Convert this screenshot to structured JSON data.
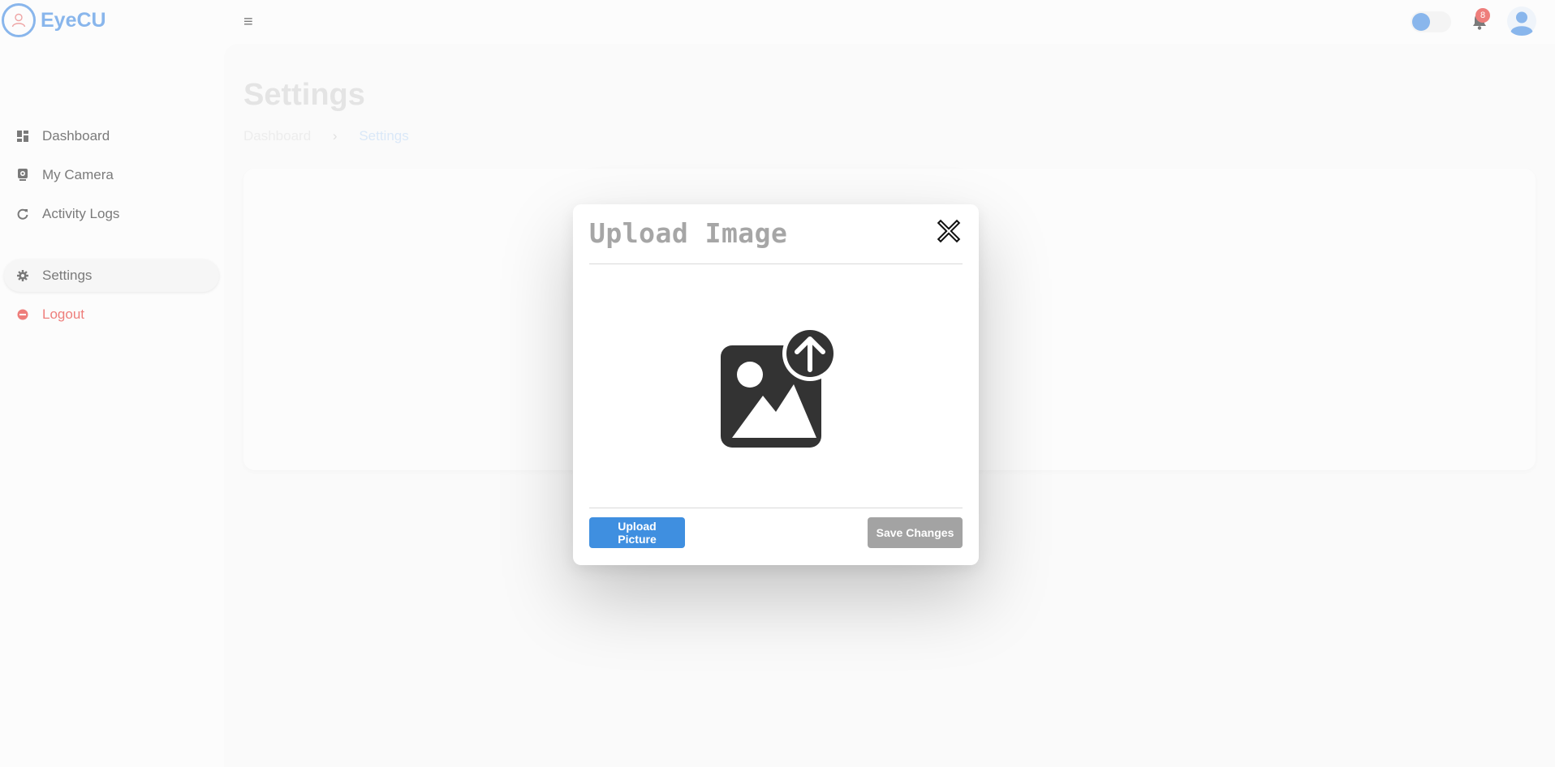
{
  "app": {
    "name": "EyeCU"
  },
  "header": {
    "notification_count": "8",
    "theme_toggle_on": true
  },
  "sidebar": {
    "items": [
      {
        "label": "Dashboard",
        "icon": "dashboard-icon"
      },
      {
        "label": "My Camera",
        "icon": "camera-icon"
      },
      {
        "label": "Activity Logs",
        "icon": "refresh-icon"
      },
      {
        "label": "Settings",
        "icon": "gear-icon",
        "active": true
      },
      {
        "label": "Logout",
        "icon": "logout-icon"
      }
    ]
  },
  "page": {
    "title": "Settings",
    "breadcrumb": {
      "root": "Dashboard",
      "separator": "›",
      "current": "Settings"
    }
  },
  "modal": {
    "title": "Upload Image",
    "upload_button": "Upload Picture",
    "save_button": "Save Changes"
  },
  "colors": {
    "accent": "#4a90e2",
    "danger": "#e53935",
    "disabled": "#a3a3a3"
  }
}
